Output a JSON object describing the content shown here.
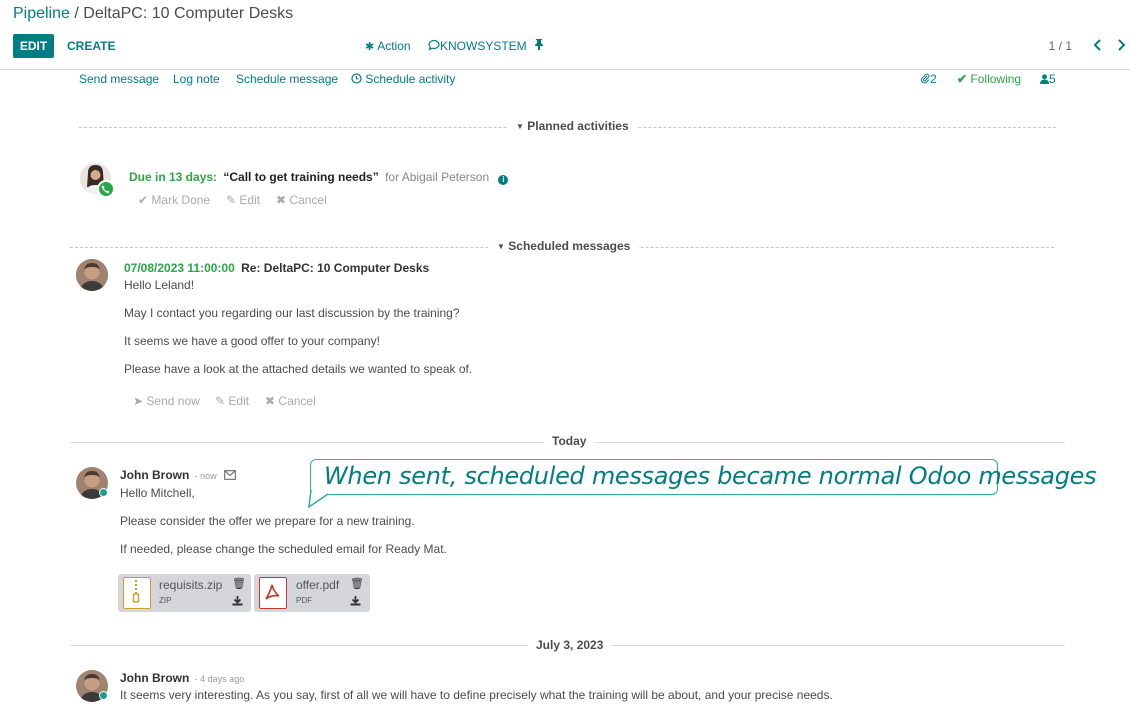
{
  "breadcrumb": {
    "parent": "Pipeline",
    "separator": " / ",
    "current": "DeltaPC: 10 Computer Desks"
  },
  "control_panel": {
    "edit_label": "EDIT",
    "create_label": "CREATE",
    "action_label": "Action",
    "knowsystem_label": "KNOWSYSTEM",
    "pager": "1 / 1"
  },
  "chatter_topbar": {
    "send_message": "Send message",
    "log_note": "Log note",
    "schedule_message": "Schedule message",
    "schedule_activity": "Schedule activity",
    "attachments_count": "2",
    "following": "Following",
    "followers_count": "5"
  },
  "planned": {
    "header": "Planned activities",
    "due": "Due in 13 days:",
    "summary": "“Call to get training needs”",
    "for_user": "for Abigail Peterson",
    "mark_done": "Mark Done",
    "edit": "Edit",
    "cancel": "Cancel"
  },
  "scheduled": {
    "header": "Scheduled messages",
    "date": "07/08/2023 11:00:00",
    "subject": "Re: DeltaPC: 10 Computer Desks",
    "lines": [
      "Hello Leland!",
      "May I contact you regarding our last discussion by the training?",
      "It seems we have a good offer to your company!",
      "Please have a look at the attached details we wanted to speak of."
    ],
    "send_now": "Send now",
    "edit": "Edit",
    "cancel": "Cancel"
  },
  "today": {
    "header": "Today",
    "author": "John Brown",
    "time": "- now",
    "lines": [
      "Hello Mitchell,",
      "Please consider the offer we prepare for a new training.",
      "If needed, please change the scheduled email for Ready Mat."
    ],
    "attachments": [
      {
        "name": "requisits.zip",
        "type": "ZIP"
      },
      {
        "name": "offer.pdf",
        "type": "PDF"
      }
    ]
  },
  "older": {
    "header": "July 3, 2023",
    "author": "John Brown",
    "time": "- 4 days ago",
    "text": "It seems very interesting. As you say, first of all we will have to define precisely what the training will be about, and your precise needs."
  },
  "callout": {
    "text": "When sent, scheduled messages became normal Odoo messages"
  },
  "colors": {
    "primary": "#017e84",
    "success": "#28a745",
    "callout_border": "#2ab397"
  }
}
